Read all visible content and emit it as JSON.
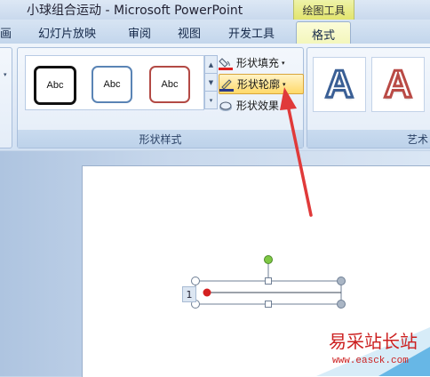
{
  "window": {
    "title": "小球组合运动 - Microsoft PowerPoint",
    "tool_tab_header": "绘图工具"
  },
  "tabs": [
    {
      "label": "画"
    },
    {
      "label": "幻灯片放映"
    },
    {
      "label": "审阅"
    },
    {
      "label": "视图"
    },
    {
      "label": "开发工具"
    }
  ],
  "active_tab": {
    "label": "格式"
  },
  "ribbon": {
    "shape_styles": {
      "label": "形状样式",
      "swatches": [
        {
          "text": "Abc",
          "border_color": "#111111"
        },
        {
          "text": "Abc",
          "border_color": "#5a84b5"
        },
        {
          "text": "Abc",
          "border_color": "#b34a45"
        }
      ],
      "commands": {
        "fill": "形状填充",
        "outline": "形状轮廓",
        "effects": "形状效果"
      }
    },
    "wordart_styles": {
      "label": "艺术",
      "letters": [
        {
          "text": "A",
          "outline_color": "#3a5f95"
        },
        {
          "text": "A",
          "outline_color": "#b94a45"
        }
      ]
    }
  },
  "slide": {
    "row_label": "1"
  },
  "watermark": {
    "title": "易采站长站",
    "url": "www.easck.com"
  },
  "colors": {
    "arrow": "#e03a3a",
    "rotate_handle": "#7ec843",
    "ball": "#d42020",
    "highlight": "#ffd96a"
  }
}
